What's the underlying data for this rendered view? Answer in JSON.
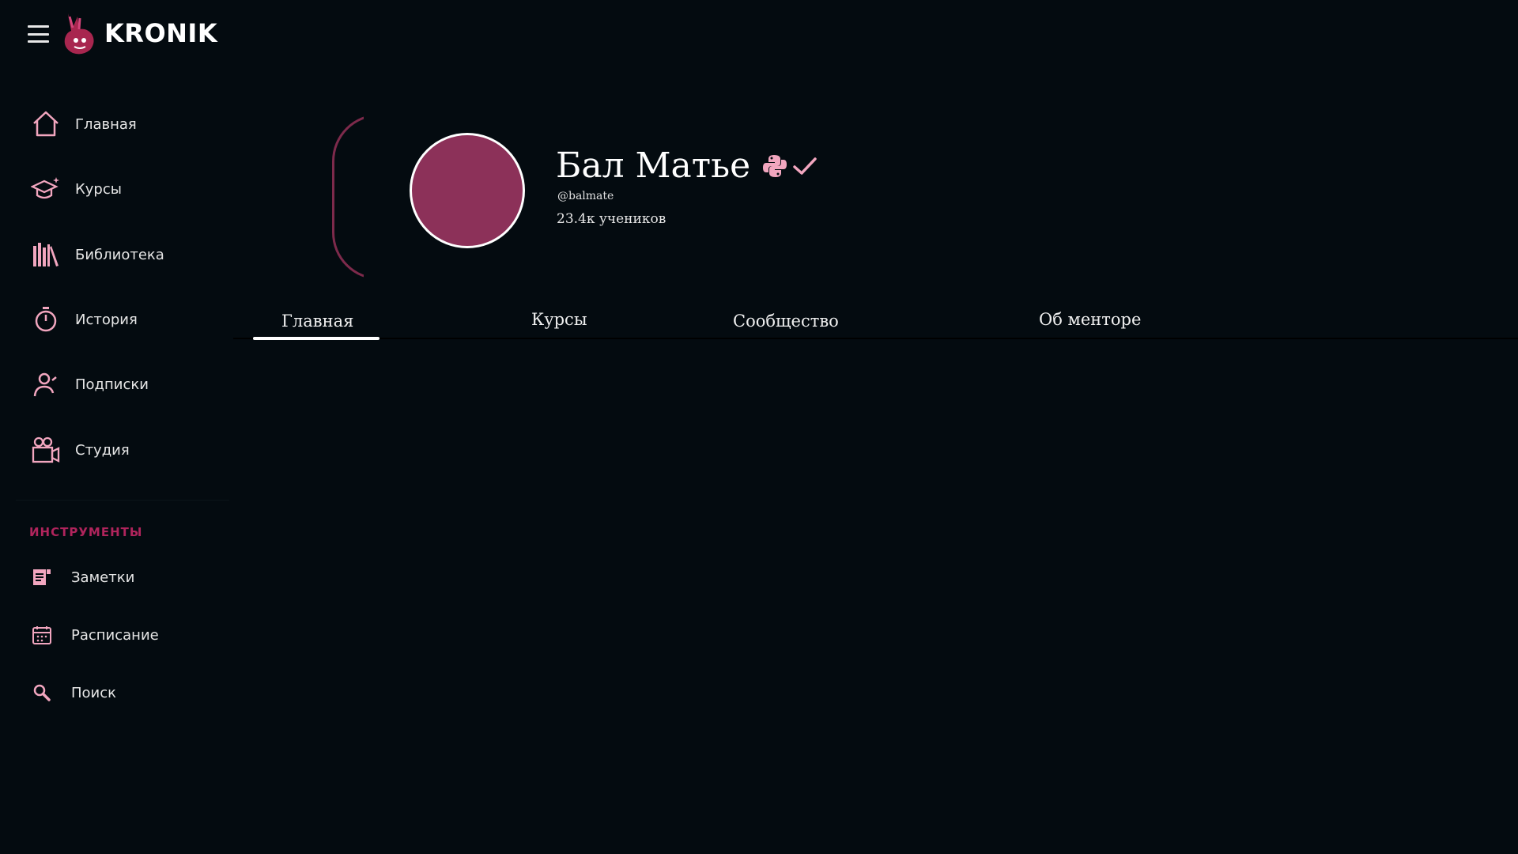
{
  "header": {
    "logo_text": "KRONIK",
    "menu_icon": "hamburger-icon",
    "logo_icon": "bunny-logo-icon"
  },
  "sidebar": {
    "items": [
      {
        "label": "Главная",
        "icon": "home-icon"
      },
      {
        "label": "Курсы",
        "icon": "graduation-cap-icon"
      },
      {
        "label": "Библиотека",
        "icon": "library-icon"
      },
      {
        "label": "История",
        "icon": "stopwatch-icon"
      },
      {
        "label": "Подписки",
        "icon": "user-icon"
      },
      {
        "label": "Студия",
        "icon": "camera-icon"
      }
    ],
    "tools_title": "ИНСТРУМЕНТЫ",
    "tools": [
      {
        "label": "Заметки",
        "icon": "notes-icon"
      },
      {
        "label": "Расписание",
        "icon": "calendar-icon"
      },
      {
        "label": "Поиск",
        "icon": "search-icon"
      }
    ]
  },
  "profile": {
    "name": "Бал Матье",
    "handle": "@balmate",
    "followers": "23.4к учеников",
    "badges": [
      "python-icon",
      "checkmark-icon"
    ]
  },
  "tabs": [
    {
      "label": "Главная",
      "active": true
    },
    {
      "label": "Курсы",
      "active": false
    },
    {
      "label": "Сообщество",
      "active": false
    },
    {
      "label": "Об менторе",
      "active": false
    }
  ],
  "colors": {
    "background": "#040b10",
    "accent": "#b0245c",
    "avatar": "#8c3159",
    "icon_pink": "#f2a6bf"
  }
}
